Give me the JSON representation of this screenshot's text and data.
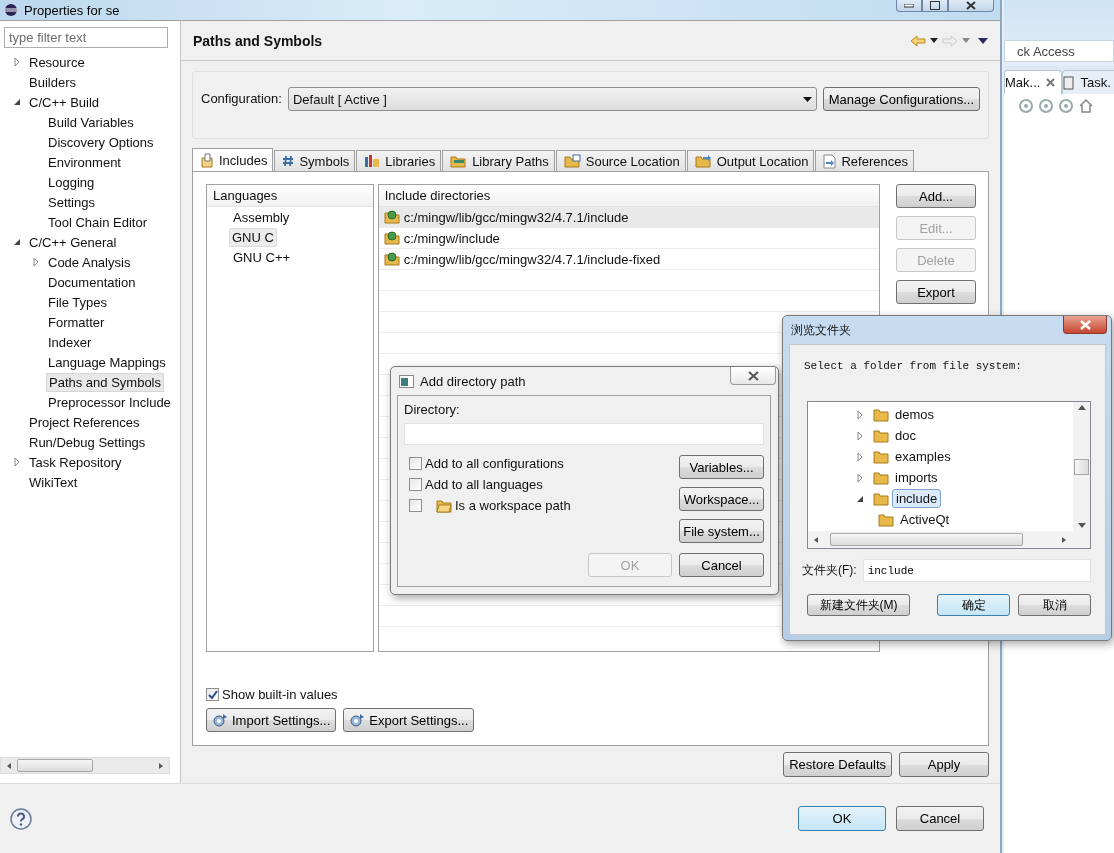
{
  "window": {
    "title": "Properties for se"
  },
  "filter": {
    "placeholder": "type filter text"
  },
  "tree": [
    {
      "label": "Resource",
      "expanded": false,
      "selected": false
    },
    {
      "label": "Builders",
      "selected": false
    },
    {
      "label": "C/C++ Build",
      "expanded": true,
      "selected": false,
      "children": [
        {
          "label": "Build Variables",
          "selected": false
        },
        {
          "label": "Discovery Options",
          "selected": false
        },
        {
          "label": "Environment",
          "selected": false
        },
        {
          "label": "Logging",
          "selected": false
        },
        {
          "label": "Settings",
          "selected": false
        },
        {
          "label": "Tool Chain Editor",
          "selected": false
        }
      ]
    },
    {
      "label": "C/C++ General",
      "expanded": true,
      "selected": false,
      "children": [
        {
          "label": "Code Analysis",
          "expanded": false,
          "selected": false
        },
        {
          "label": "Documentation",
          "selected": false
        },
        {
          "label": "File Types",
          "selected": false
        },
        {
          "label": "Formatter",
          "selected": false
        },
        {
          "label": "Indexer",
          "selected": false
        },
        {
          "label": "Language Mappings",
          "selected": false
        },
        {
          "label": "Paths and Symbols",
          "selected": true
        },
        {
          "label": "Preprocessor Include",
          "selected": false
        }
      ]
    },
    {
      "label": "Project References",
      "selected": false
    },
    {
      "label": "Run/Debug Settings",
      "selected": false
    },
    {
      "label": "Task Repository",
      "expanded": false,
      "selected": false
    },
    {
      "label": "WikiText",
      "selected": false
    }
  ],
  "page": {
    "title": "Paths and Symbols"
  },
  "configuration": {
    "label": "Configuration:",
    "value": "Default  [ Active ]",
    "button": "Manage Configurations..."
  },
  "tabs": [
    {
      "label": "Includes",
      "selected": true
    },
    {
      "label": "Symbols",
      "selected": false
    },
    {
      "label": "Libraries",
      "selected": false
    },
    {
      "label": "Library Paths",
      "selected": false
    },
    {
      "label": "Source Location",
      "selected": false
    },
    {
      "label": "Output Location",
      "selected": false
    },
    {
      "label": "References",
      "selected": false
    }
  ],
  "languages": {
    "heading": "Languages",
    "items": [
      {
        "label": "Assembly",
        "selected": false
      },
      {
        "label": "GNU C",
        "selected": true
      },
      {
        "label": "GNU C++",
        "selected": false
      }
    ]
  },
  "directories": {
    "heading": "Include directories",
    "rows": [
      {
        "path": "c:/mingw/lib/gcc/mingw32/4.7.1/include",
        "selected": true
      },
      {
        "path": "c:/mingw/include",
        "selected": false
      },
      {
        "path": "c:/mingw/lib/gcc/mingw32/4.7.1/include-fixed",
        "selected": false
      }
    ]
  },
  "side_buttons": [
    {
      "label": "Add...",
      "disabled": false
    },
    {
      "label": "Edit...",
      "disabled": true
    },
    {
      "label": "Delete",
      "disabled": true
    },
    {
      "label": "Export",
      "disabled": false
    }
  ],
  "show_builtin": {
    "label": "Show built-in values",
    "checked": true
  },
  "settings_buttons": [
    "Import Settings...",
    "Export Settings..."
  ],
  "page_buttons": [
    "Restore Defaults",
    "Apply"
  ],
  "footer_buttons": [
    {
      "label": "OK",
      "default": true
    },
    {
      "label": "Cancel",
      "default": false
    }
  ],
  "workbench": {
    "quick_access": "ck Access",
    "tabs": [
      {
        "label": "Mak...",
        "selected": true
      },
      {
        "label": "Task.",
        "selected": false
      }
    ]
  },
  "add_dialog": {
    "title": "Add directory path",
    "field_label": "Directory:",
    "options": [
      {
        "label": "Add to all configurations",
        "checked": false,
        "kind": "plain"
      },
      {
        "label": "Add to all languages",
        "checked": false,
        "kind": "plain"
      },
      {
        "label": "Is a workspace path",
        "checked": false,
        "kind": "workspace"
      }
    ],
    "buttons": [
      "Variables...",
      "Workspace...",
      "File system..."
    ],
    "ok": {
      "label": "OK",
      "disabled": true
    },
    "cancel": "Cancel"
  },
  "browse_dialog": {
    "title": "浏览文件夹",
    "prompt": "Select a folder from file system:",
    "folders": [
      {
        "label": "demos",
        "expanded": false,
        "selected": false
      },
      {
        "label": "doc",
        "expanded": false,
        "selected": false
      },
      {
        "label": "examples",
        "expanded": false,
        "selected": false
      },
      {
        "label": "imports",
        "expanded": false,
        "selected": false
      },
      {
        "label": "include",
        "expanded": true,
        "selected": true,
        "children": [
          {
            "label": "ActiveQt",
            "selected": false
          }
        ]
      }
    ],
    "folder_label": "文件夹(F):",
    "folder_value": "include",
    "buttons": [
      {
        "label": "新建文件夹(M)",
        "default": false
      },
      {
        "label": "确定",
        "default": true
      },
      {
        "label": "取消",
        "default": false
      }
    ]
  }
}
